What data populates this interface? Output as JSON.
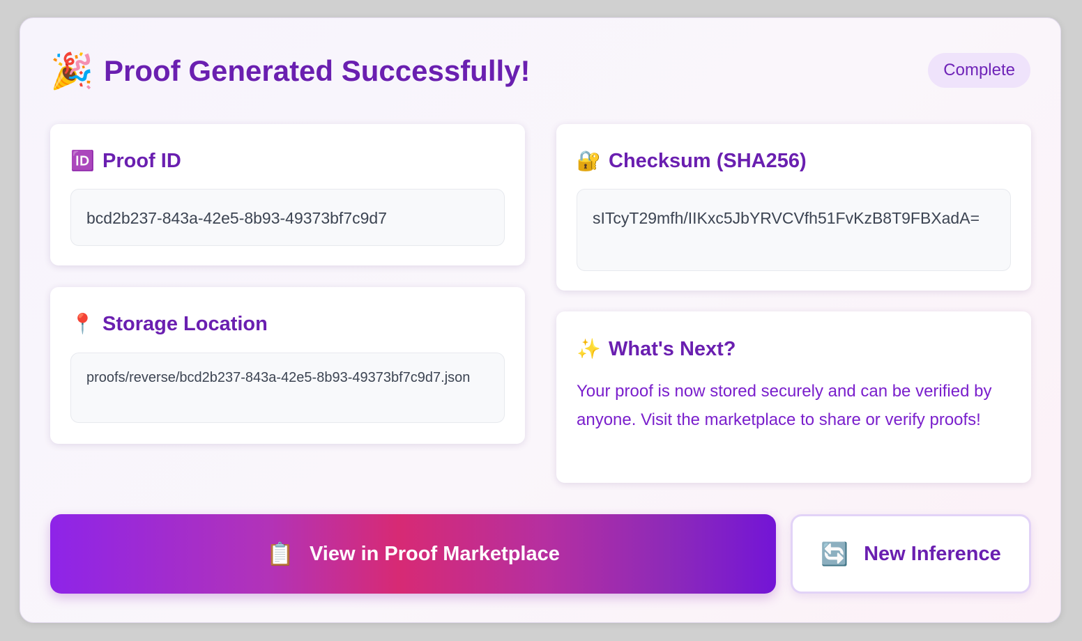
{
  "header": {
    "icon": "party-popper-icon",
    "emoji": "🎉",
    "title": "Proof Generated Successfully!",
    "status": "Complete"
  },
  "cards": {
    "proof_id": {
      "icon": "id-icon",
      "emoji": "🆔",
      "title": "Proof ID",
      "value": "bcd2b237-843a-42e5-8b93-49373bf7c9d7"
    },
    "storage": {
      "icon": "pushpin-icon",
      "emoji": "📍",
      "title": "Storage Location",
      "value": "proofs/reverse/bcd2b237-843a-42e5-8b93-49373bf7c9d7.json"
    },
    "checksum": {
      "icon": "lock-key-icon",
      "emoji": "🔐",
      "title": "Checksum (SHA256)",
      "value": "sITcyT29mfh/IIKxc5JbYRVCVfh51FvKzB8T9FBXadA="
    },
    "next": {
      "icon": "sparkles-icon",
      "emoji": "✨",
      "title": "What's Next?",
      "text": "Your proof is now stored securely and can be verified by anyone. Visit the marketplace to share or verify proofs!"
    }
  },
  "actions": {
    "marketplace": {
      "icon": "clipboard-icon",
      "emoji": "📋",
      "label": "View in Proof Marketplace"
    },
    "new_inference": {
      "icon": "refresh-icon",
      "emoji": "🔄",
      "label": "New Inference"
    }
  },
  "colors": {
    "accent": "#6a1fb0",
    "badge_bg": "#efe3fb",
    "gradient_start": "#8e24e8",
    "gradient_mid": "#d72a74",
    "gradient_end": "#7315d6"
  }
}
